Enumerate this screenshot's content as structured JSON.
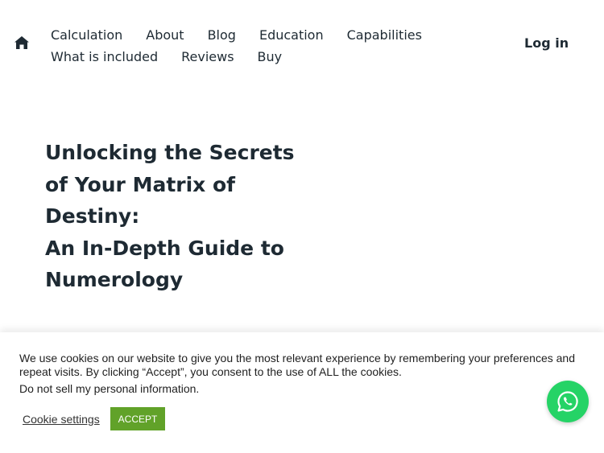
{
  "header": {
    "home_icon": "home-icon",
    "nav_rows": [
      [
        "Calculation",
        "About",
        "Blog",
        "Education",
        "Capabilities"
      ],
      [
        "What is included",
        "Reviews",
        "Buy"
      ]
    ],
    "login_label": "Log in"
  },
  "hero": {
    "title_lines": [
      "Unlocking the Secrets",
      "of Your Matrix of",
      "Destiny:",
      "An In-Depth Guide to",
      "Numerology"
    ]
  },
  "cookie_banner": {
    "message": "We use cookies on our website to give you the most relevant experience by remembering your preferences and repeat visits. By clicking “Accept”, you consent to the use of ALL the cookies.",
    "do_not_sell": "Do not sell my personal information.",
    "settings_label": "Cookie settings",
    "accept_label": "ACCEPT"
  },
  "whatsapp": {
    "icon": "whatsapp-icon",
    "color": "#25d366"
  },
  "colors": {
    "text": "#1e2a33",
    "accept_button": "#61a229"
  }
}
